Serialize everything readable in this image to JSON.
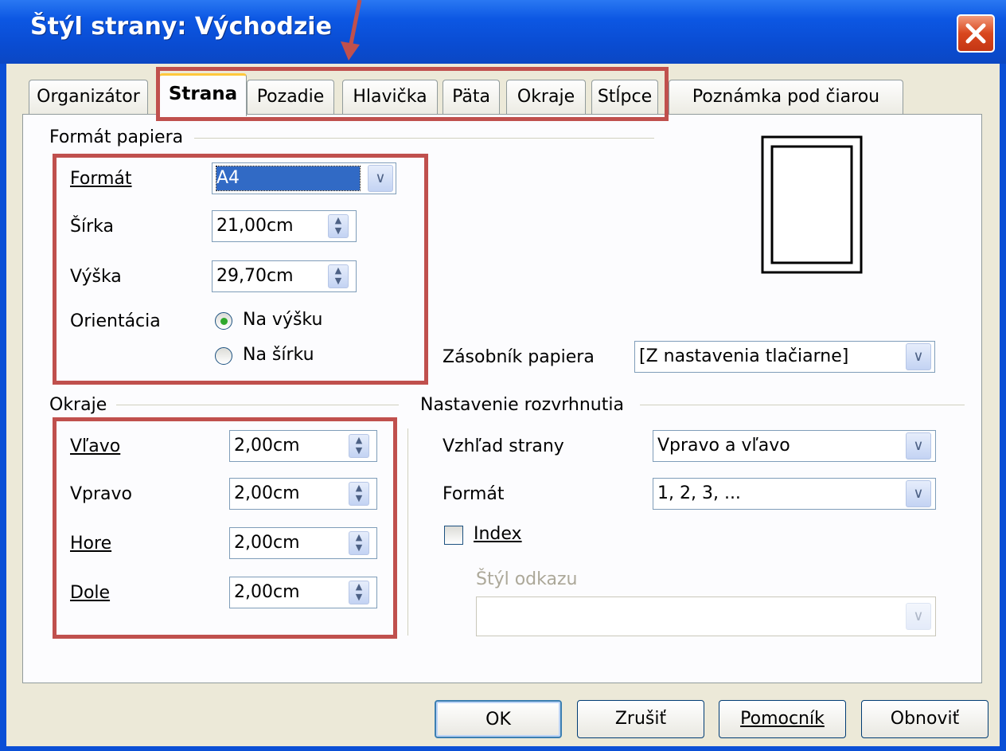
{
  "window": {
    "title": "Štýl strany: Východzie",
    "close_icon": "close-icon"
  },
  "tabs": [
    {
      "label": "Organizátor",
      "active": false
    },
    {
      "label": "Strana",
      "active": true
    },
    {
      "label": "Pozadie",
      "active": false
    },
    {
      "label": "Hlavička",
      "active": false
    },
    {
      "label": "Päta",
      "active": false
    },
    {
      "label": "Okraje",
      "active": false
    },
    {
      "label": "Stĺpce",
      "active": false
    },
    {
      "label": "Poznámka pod čiarou",
      "active": false
    }
  ],
  "paper_format": {
    "section_title": "Formát papiera",
    "format_label": "Formát",
    "format_value": "A4",
    "width_label": "Šírka",
    "width_value": "21,00cm",
    "height_label": "Výška",
    "height_value": "29,70cm",
    "orientation_label": "Orientácia",
    "portrait_label": "Na výšku",
    "landscape_label": "Na šírku",
    "orientation_selected": "portrait",
    "paper_tray_label": "Zásobník papiera",
    "paper_tray_value": "[Z nastavenia tlačiarne]"
  },
  "margins": {
    "section_title": "Okraje",
    "left_label": "Vľavo",
    "left_value": "2,00cm",
    "right_label": "Vpravo",
    "right_value": "2,00cm",
    "top_label": "Hore",
    "top_value": "2,00cm",
    "bottom_label": "Dole",
    "bottom_value": "2,00cm"
  },
  "layout": {
    "section_title": "Nastavenie rozvrhnutia",
    "page_layout_label": "Vzhľad strany",
    "page_layout_value": "Vpravo a vľavo",
    "format_label": "Formát",
    "format_value": "1, 2, 3, ...",
    "register_label": "Index",
    "register_checked": false,
    "reference_style_label": "Štýl odkazu",
    "reference_style_value": ""
  },
  "buttons": {
    "ok": "OK",
    "cancel": "Zrušiť",
    "help": "Pomocník",
    "reset": "Obnoviť"
  },
  "annotation_color": "#c0504d"
}
